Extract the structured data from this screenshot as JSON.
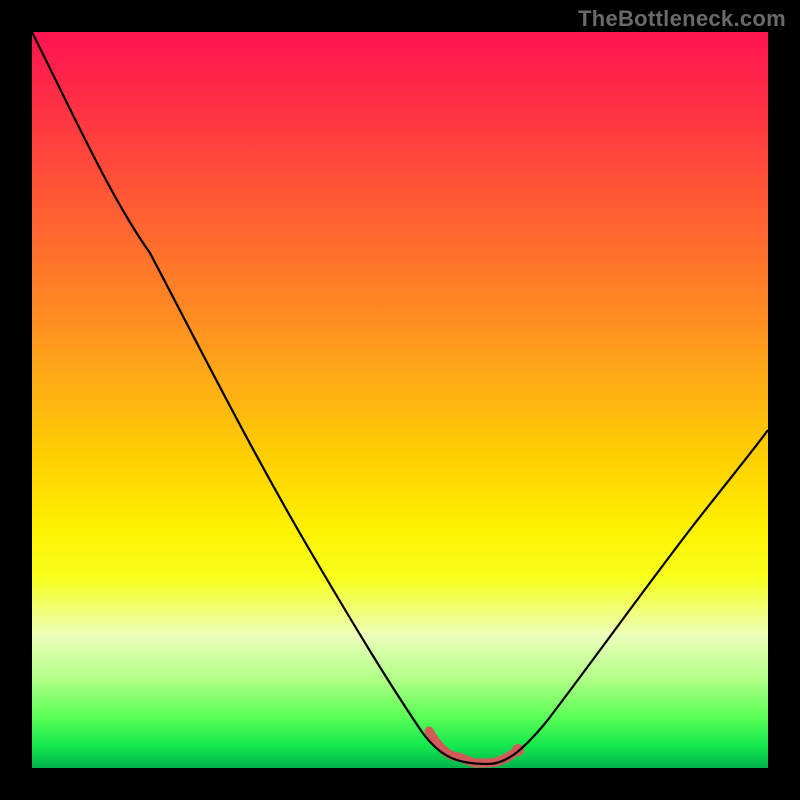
{
  "watermark": "TheBottleneck.com",
  "colors": {
    "page_bg": "#000000",
    "curve": "#000000",
    "good_zone_stroke": "#d45a5a",
    "watermark": "#6a6a6a"
  },
  "chart_data": {
    "type": "line",
    "title": "",
    "xlabel": "",
    "ylabel": "",
    "xlim": [
      0,
      100
    ],
    "ylim": [
      0,
      100
    ],
    "grid": false,
    "series": [
      {
        "name": "bottleneck_curve",
        "x": [
          0,
          8,
          16,
          24,
          32,
          40,
          46,
          50,
          54,
          58,
          60,
          62,
          66,
          70,
          76,
          84,
          92,
          100
        ],
        "values": [
          100,
          85,
          70,
          55,
          41,
          28,
          17,
          10,
          4.5,
          1.4,
          0.6,
          0.6,
          1.6,
          4.2,
          10,
          22,
          35,
          48
        ]
      }
    ],
    "annotations": [
      {
        "name": "good_zone",
        "x_range": [
          54,
          66
        ],
        "note": "flat bottom segment drawn with thick red stroke; dot at upper end"
      }
    ]
  }
}
